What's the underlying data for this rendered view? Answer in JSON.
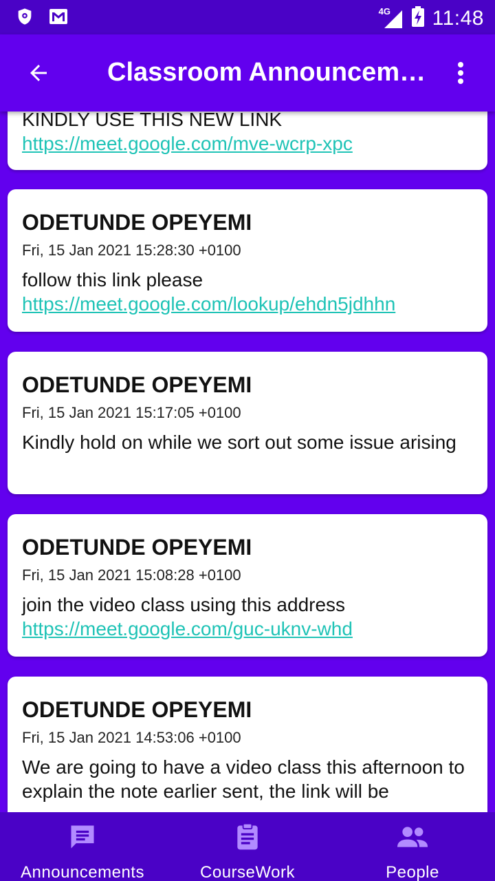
{
  "status_bar": {
    "time": "11:48",
    "network": "4G"
  },
  "app_bar": {
    "title": "Classroom Announcements"
  },
  "announcements": [
    {
      "text": "KINDLY USE THIS NEW LINK",
      "link": "https://meet.google.com/mve-wcrp-xpc"
    },
    {
      "author": "ODETUNDE OPEYEMI",
      "date": "Fri, 15 Jan 2021 15:28:30 +0100",
      "text": "follow this link please",
      "link": "https://meet.google.com/lookup/ehdn5jdhhn"
    },
    {
      "author": "ODETUNDE OPEYEMI",
      "date": "Fri, 15 Jan 2021 15:17:05 +0100",
      "text": "Kindly hold on while we sort out some issue arising"
    },
    {
      "author": "ODETUNDE OPEYEMI",
      "date": "Fri, 15 Jan 2021 15:08:28 +0100",
      "text": "join the video class using this address",
      "link": "https://meet.google.com/guc-uknv-whd"
    },
    {
      "author": "ODETUNDE OPEYEMI",
      "date": "Fri, 15 Jan 2021 14:53:06 +0100",
      "text": "We are going to have a video class this afternoon to explain the note earlier sent, the link will be"
    }
  ],
  "bottom_nav": {
    "items": [
      {
        "label": "Announcements",
        "icon": "announcement-icon"
      },
      {
        "label": "CourseWork",
        "icon": "clipboard-icon"
      },
      {
        "label": "People",
        "icon": "people-icon"
      }
    ]
  },
  "colors": {
    "primary": "#6200EE",
    "primary_dark": "#4A02C6",
    "link": "#1FC3B6",
    "nav_icon": "#B28BFF"
  }
}
